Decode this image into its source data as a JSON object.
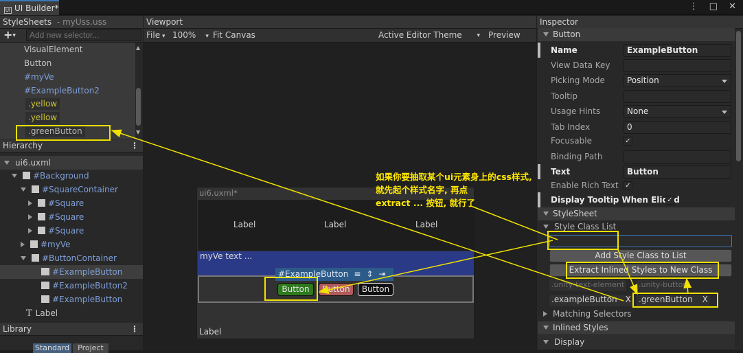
{
  "window": {
    "tab_title": "UI Builder*",
    "controls": "⋮ □ ✕"
  },
  "stylesheets": {
    "title": "StyleSheets",
    "subtitle": "- myUss.uss",
    "add_selector_placeholder": "Add new selector...",
    "items": [
      {
        "label": "VisualElement",
        "style": "plain"
      },
      {
        "label": "Button",
        "style": "plain"
      },
      {
        "label": "#myVe",
        "style": "blue"
      },
      {
        "label": "#ExampleButton2",
        "style": "blue"
      },
      {
        "label": ".yellow",
        "style": "yellow"
      },
      {
        "label": ".yellow",
        "style": "yellow"
      },
      {
        "label": ".greenButton",
        "style": "green"
      }
    ]
  },
  "hierarchy": {
    "title": "Hierarchy",
    "root": "ui6.uxml",
    "items": [
      {
        "label": "#Background"
      },
      {
        "label": "#SquareContainer"
      },
      {
        "label": "#Square"
      },
      {
        "label": "#Square"
      },
      {
        "label": "#Square"
      },
      {
        "label": "#myVe"
      },
      {
        "label": "#ButtonContainer"
      },
      {
        "label": "#ExampleButton"
      },
      {
        "label": "#ExampleButton2"
      },
      {
        "label": "#ExampleButton"
      },
      {
        "label": "Label"
      }
    ]
  },
  "library": {
    "title": "Library",
    "tabs": [
      "Standard",
      "Project"
    ]
  },
  "viewport": {
    "title": "Viewport",
    "file_menu": "File",
    "zoom": "100%",
    "fit_canvas": "Fit Canvas",
    "theme": "Active Editor Theme",
    "preview": "Preview",
    "canvas_title": "ui6.uxml*",
    "labels": [
      "Label",
      "Label",
      "Label"
    ],
    "myve_text": "myVe text ...",
    "selected_element": "#ExampleButton",
    "buttons": [
      "Button",
      "Button",
      "Button"
    ],
    "bottom_label": "Label"
  },
  "inspector": {
    "title": "Inspector",
    "section_button": "Button",
    "fields": {
      "name_label": "Name",
      "name_value": "ExampleButton",
      "view_data_key": "View Data Key",
      "picking_mode_label": "Picking Mode",
      "picking_mode_value": "Position",
      "tooltip": "Tooltip",
      "usage_hints_label": "Usage Hints",
      "usage_hints_value": "None",
      "tab_index_label": "Tab Index",
      "tab_index_value": "0",
      "focusable": "Focusable",
      "binding_path": "Binding Path",
      "text_label": "Text",
      "text_value": "Button",
      "enable_rich_text": "Enable Rich Text",
      "display_tooltip": "Display Tooltip When Elided"
    },
    "section_stylesheet": "StyleSheet",
    "style_class_list": "Style Class List",
    "add_style_class": "Add Style Class to List",
    "extract_button": "Extract Inlined Styles to New Class",
    "inherited_classes": [
      ".unity-text-element",
      ".unity-button"
    ],
    "classes": [
      {
        "label": ".exampleButton",
        "remove": "X"
      },
      {
        "label": ".greenButton",
        "remove": "X"
      }
    ],
    "matching_selectors": "Matching Selectors",
    "inlined_styles": "Inlined Styles",
    "display": "Display"
  },
  "annotation": {
    "lines": [
      "如果你要抽取某个ui元素身上的css样式,",
      "就先起个样式名字, 再点",
      "extract ... 按钮, 就行了"
    ]
  },
  "colors": {
    "highlight": "#f2e200",
    "blue_text": "#7f9fd9",
    "green_button": "#2f7a1e",
    "red_button": "#b35a5a",
    "selection_blue": "#3a79bb"
  }
}
